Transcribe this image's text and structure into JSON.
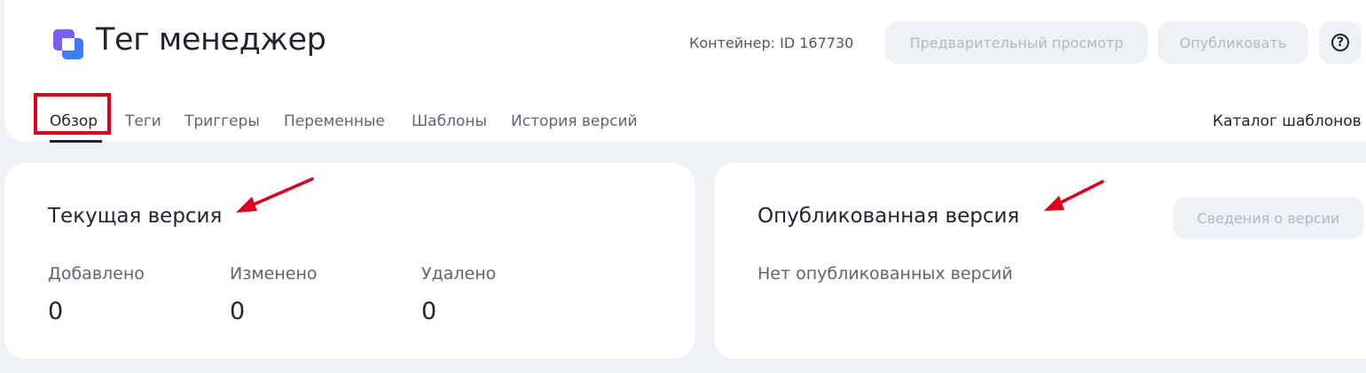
{
  "header": {
    "app_title": "Тег менеджер",
    "container_label": "Контейнер: ID 167730",
    "preview_button": "Предварительный просмотр",
    "publish_button": "Опубликовать",
    "help_icon": "question-circle-icon",
    "logo_icon": "tag-manager-logo"
  },
  "nav": {
    "tabs": [
      {
        "label": "Обзор",
        "active": true
      },
      {
        "label": "Теги",
        "active": false
      },
      {
        "label": "Триггеры",
        "active": false
      },
      {
        "label": "Переменные",
        "active": false
      },
      {
        "label": "Шаблоны",
        "active": false
      },
      {
        "label": "История версий",
        "active": false
      }
    ],
    "catalog_link": "Каталог шаблонов"
  },
  "current_version": {
    "title": "Текущая версия",
    "stats": [
      {
        "label": "Добавлено",
        "value": "0"
      },
      {
        "label": "Изменено",
        "value": "0"
      },
      {
        "label": "Удалено",
        "value": "0"
      }
    ]
  },
  "published_version": {
    "title": "Опубликованная версия",
    "details_button": "Сведения о версии",
    "empty_text": "Нет опубликованных версий"
  },
  "colors": {
    "accent_logo_purple": "#7b5cff",
    "accent_logo_blue": "#3d7bff",
    "annotation_red": "#e0001b",
    "background": "#eef1f5"
  }
}
